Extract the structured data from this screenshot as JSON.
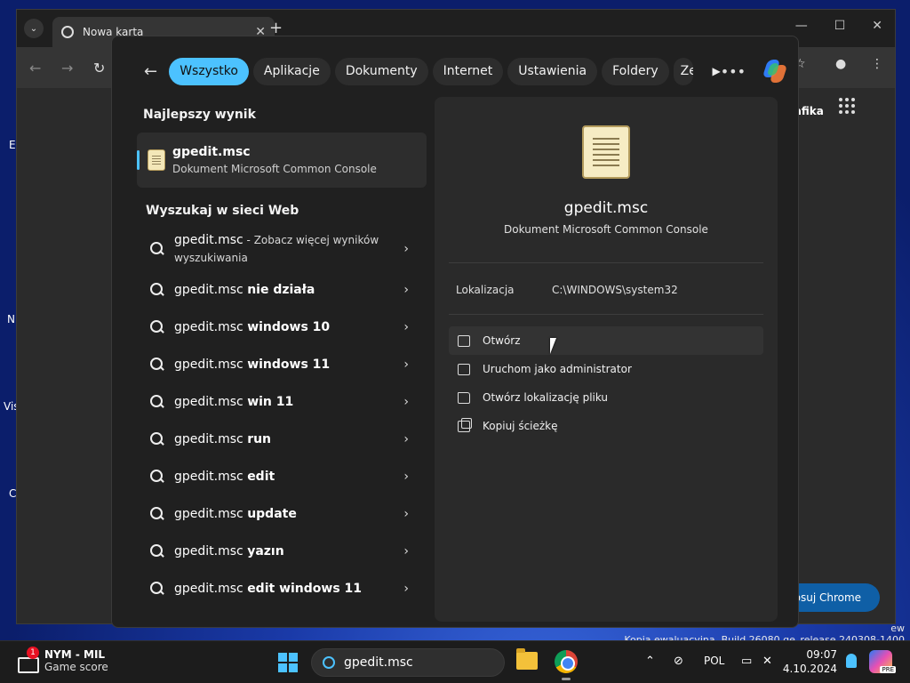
{
  "chrome": {
    "tab_title": "Nowa karta",
    "tab_close": "✕",
    "new_tab": "+",
    "grafika": "Grafika",
    "customize": "tosuj Chrome"
  },
  "search": {
    "filters": [
      {
        "label": "Wszystko",
        "active": true
      },
      {
        "label": "Aplikacje"
      },
      {
        "label": "Dokumenty"
      },
      {
        "label": "Internet"
      },
      {
        "label": "Ustawienia"
      },
      {
        "label": "Foldery"
      },
      {
        "label": "Ze"
      }
    ],
    "best_match_heading": "Najlepszy wynik",
    "best_match": {
      "title": "gpedit.msc",
      "subtitle": "Dokument Microsoft Common Console"
    },
    "web_heading": "Wyszukaj w sieci Web",
    "web_items": [
      {
        "base": "gpedit.msc",
        "bold": "",
        "hint": " - Zobacz więcej wyników wyszukiwania"
      },
      {
        "base": "gpedit.msc ",
        "bold": "nie działa",
        "hint": ""
      },
      {
        "base": "gpedit.msc ",
        "bold": "windows 10",
        "hint": ""
      },
      {
        "base": "gpedit.msc ",
        "bold": "windows 11",
        "hint": ""
      },
      {
        "base": "gpedit.msc ",
        "bold": "win 11",
        "hint": ""
      },
      {
        "base": "gpedit.msc ",
        "bold": "run",
        "hint": ""
      },
      {
        "base": "gpedit.msc ",
        "bold": "edit",
        "hint": ""
      },
      {
        "base": "gpedit.msc ",
        "bold": "update",
        "hint": ""
      },
      {
        "base": "gpedit.msc ",
        "bold": "yazın",
        "hint": ""
      },
      {
        "base": "gpedit.msc ",
        "bold": "edit windows 11",
        "hint": ""
      }
    ],
    "detail": {
      "title": "gpedit.msc",
      "subtitle": "Dokument Microsoft Common Console",
      "location_label": "Lokalizacja",
      "location_value": "C:\\WINDOWS\\system32",
      "actions": [
        {
          "label": "Otwórz",
          "icon": "open-external-icon"
        },
        {
          "label": "Uruchom jako administrator",
          "icon": "admin-shield-icon"
        },
        {
          "label": "Otwórz lokalizację pliku",
          "icon": "folder-icon"
        },
        {
          "label": "Kopiuj ścieżkę",
          "icon": "copy-icon"
        }
      ]
    }
  },
  "watermark": {
    "line1": "ew",
    "line2": "Kopia ewaluacyjna. Build 26080.ge_release.240308-1400"
  },
  "taskbar": {
    "widget_title": "NYM - MIL",
    "widget_subtitle": "Game score",
    "badge": "1",
    "search_value": "gpedit.msc",
    "language": "POL",
    "time": "09:07",
    "date": "4.10.2024",
    "pre_badge": "PRE"
  },
  "desktop_fragments": [
    "E",
    "N",
    "Vis",
    "C"
  ]
}
